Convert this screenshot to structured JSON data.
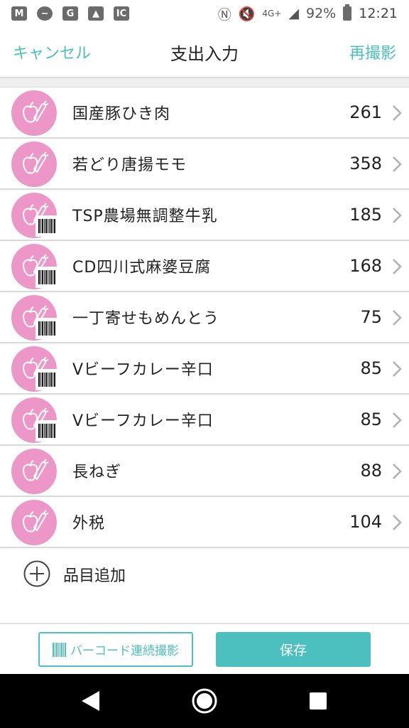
{
  "status_bar": {
    "battery": "92%",
    "time": "12:21",
    "network": "4G+"
  },
  "header": {
    "cancel_label": "キャンセル",
    "title": "支出入力",
    "retake_label": "再撮影"
  },
  "items": [
    {
      "name": "国産豚ひき肉",
      "amount": "261",
      "icon": "fruit-vegetable-icon",
      "barcode": false
    },
    {
      "name": "若どり唐揚モモ",
      "amount": "358",
      "icon": "fruit-vegetable-icon",
      "barcode": false
    },
    {
      "name": "TSP農場無調整牛乳",
      "amount": "185",
      "icon": "fruit-vegetable-icon",
      "barcode": true
    },
    {
      "name": "CD四川式麻婆豆腐",
      "amount": "168",
      "icon": "fruit-vegetable-icon",
      "barcode": true
    },
    {
      "name": "一丁寄せもめんとう",
      "amount": "75",
      "icon": "fruit-vegetable-icon",
      "barcode": true
    },
    {
      "name": "Vビーフカレー辛口",
      "amount": "85",
      "icon": "fruit-vegetable-icon",
      "barcode": true
    },
    {
      "name": "Vビーフカレー辛口",
      "amount": "85",
      "icon": "fruit-vegetable-icon",
      "barcode": true
    },
    {
      "name": "長ねぎ",
      "amount": "88",
      "icon": "fruit-vegetable-icon",
      "barcode": false
    },
    {
      "name": "外税",
      "amount": "104",
      "icon": "fruit-vegetable-icon",
      "barcode": false
    }
  ],
  "add_item_label": "品目追加",
  "toolbar": {
    "barcode_button_label": "バーコード連続撮影",
    "save_button_label": "保存"
  },
  "colors": {
    "accent": "#4cc0bf",
    "category_pink": "#ec97c8"
  }
}
